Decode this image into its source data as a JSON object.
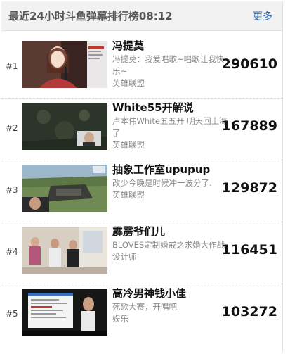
{
  "header": {
    "title": "最近24小时斗鱼弹幕排行榜08:12",
    "more_label": "更多"
  },
  "ranking": [
    {
      "rank": "#1",
      "name": "冯提莫",
      "description": "冯提莫：我爱唱歌~唱歌让我快乐~",
      "category": "英雄联盟",
      "count": "290610"
    },
    {
      "rank": "#2",
      "name": "White55开解说",
      "description": "卢本伟White五五开 明天回上海了",
      "category": "英雄联盟",
      "count": "167889"
    },
    {
      "rank": "#3",
      "name": "抽象工作室upupup",
      "description": "改少今晚是时候冲一波分了.",
      "category": "英雄联盟",
      "count": "129872"
    },
    {
      "rank": "#4",
      "name": "霹雳爷们儿",
      "description": "BLOVES定制婚戒之求婚大作战",
      "category": "设计师",
      "count": "116451"
    },
    {
      "rank": "#5",
      "name": "高冷男神钱小佳",
      "description": "死歌大赛，开唱吧",
      "category": "娱乐",
      "count": "103272"
    }
  ]
}
